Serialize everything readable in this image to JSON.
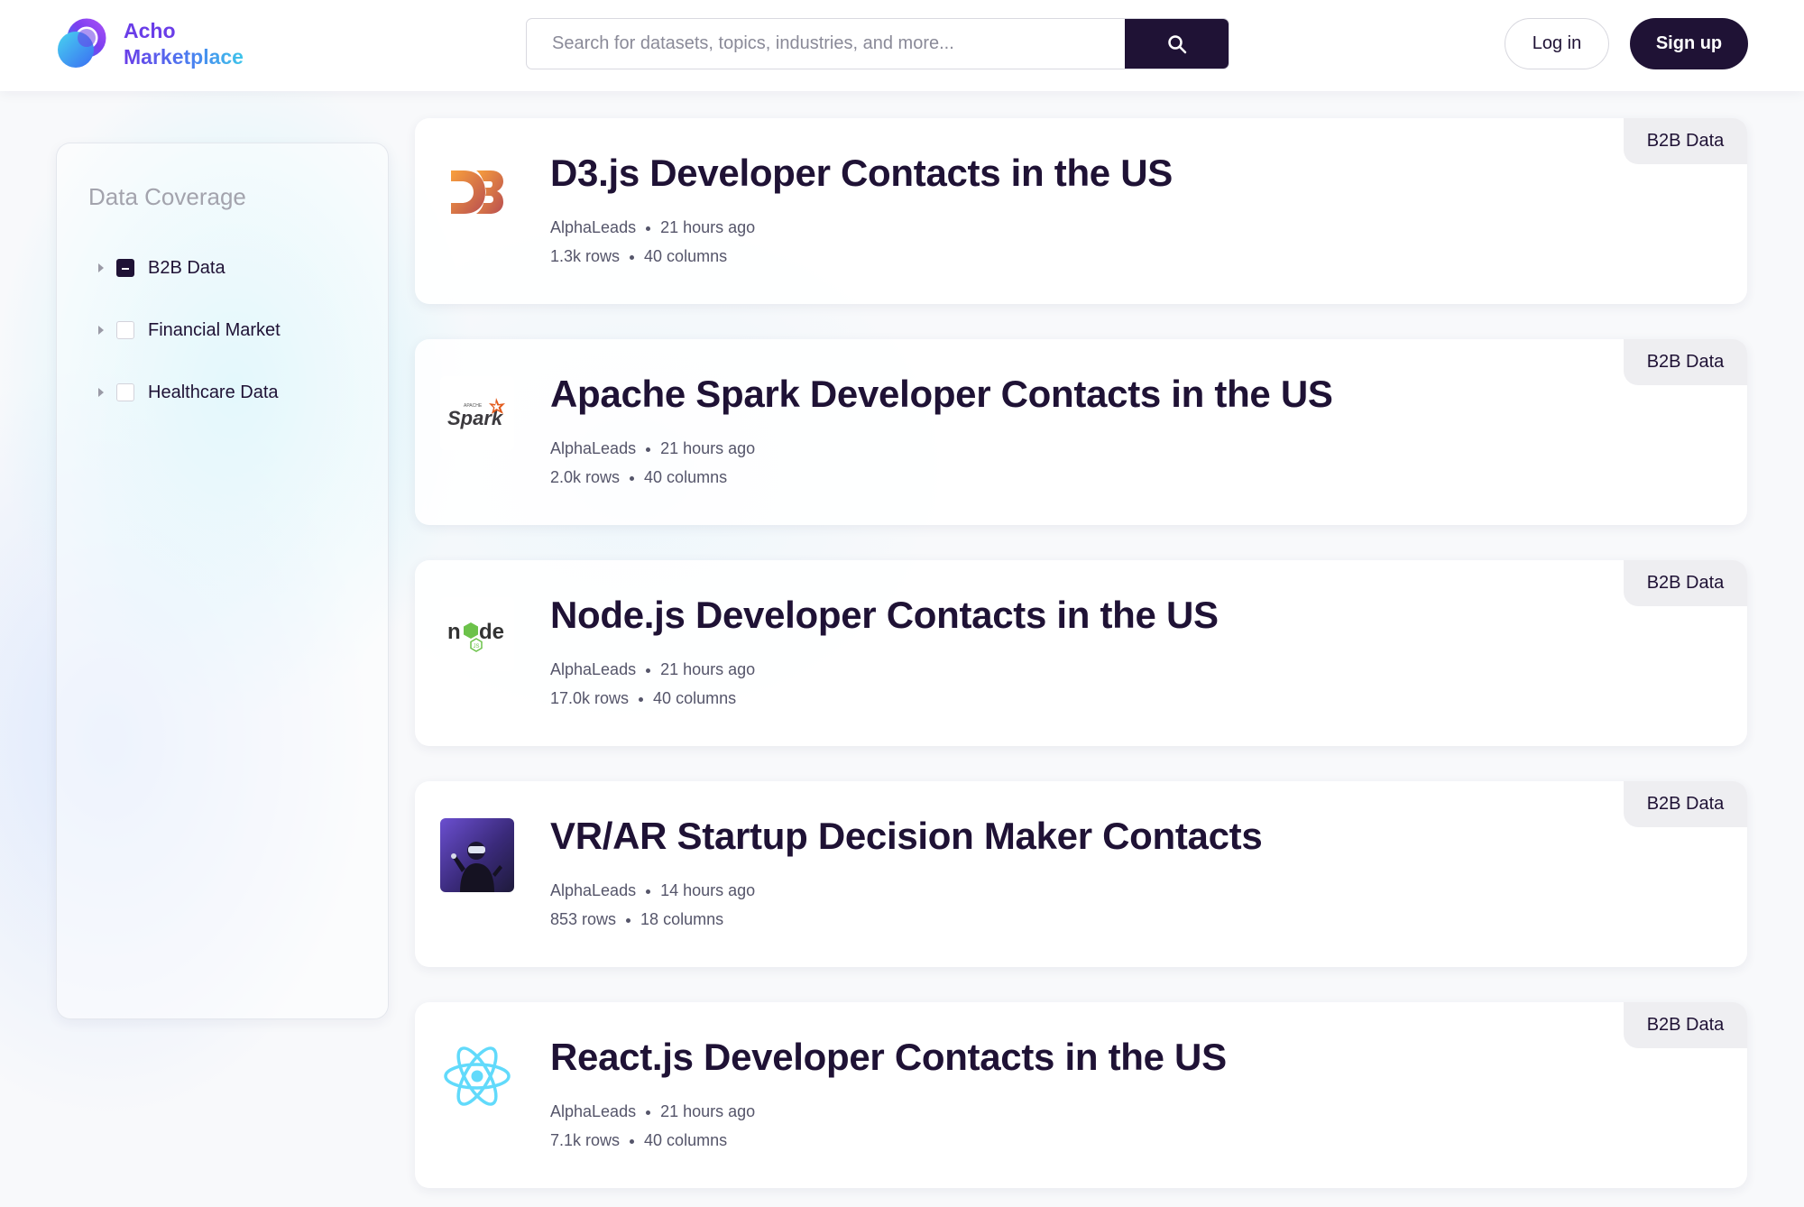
{
  "header": {
    "logo_line1": "Acho",
    "logo_line2": "Marketplace",
    "search_placeholder": "Search for datasets, topics, industries, and more...",
    "login_label": "Log in",
    "signup_label": "Sign up",
    "brand_color": "#1f1235"
  },
  "sidebar": {
    "title": "Data Coverage",
    "filters": [
      {
        "label": "B2B Data",
        "state": "indeterminate"
      },
      {
        "label": "Financial Market",
        "state": "unchecked"
      },
      {
        "label": "Healthcare Data",
        "state": "unchecked"
      }
    ]
  },
  "datasets": [
    {
      "title": "D3.js Developer Contacts in the US",
      "provider": "AlphaLeads",
      "updated": "21 hours ago",
      "rows": "1.3k rows",
      "columns": "40 columns",
      "tag": "B2B Data",
      "icon": "d3-logo-icon"
    },
    {
      "title": "Apache Spark Developer Contacts in the US",
      "provider": "AlphaLeads",
      "updated": "21 hours ago",
      "rows": "2.0k rows",
      "columns": "40 columns",
      "tag": "B2B Data",
      "icon": "spark-logo-icon"
    },
    {
      "title": "Node.js Developer Contacts in the US",
      "provider": "AlphaLeads",
      "updated": "21 hours ago",
      "rows": "17.0k rows",
      "columns": "40 columns",
      "tag": "B2B Data",
      "icon": "nodejs-logo-icon"
    },
    {
      "title": "VR/AR Startup Decision Maker Contacts",
      "provider": "AlphaLeads",
      "updated": "14 hours ago",
      "rows": "853 rows",
      "columns": "18 columns",
      "tag": "B2B Data",
      "icon": "vr-headset-photo"
    },
    {
      "title": "React.js Developer Contacts in the US",
      "provider": "AlphaLeads",
      "updated": "21 hours ago",
      "rows": "7.1k rows",
      "columns": "40 columns",
      "tag": "B2B Data",
      "icon": "react-logo-icon"
    }
  ]
}
